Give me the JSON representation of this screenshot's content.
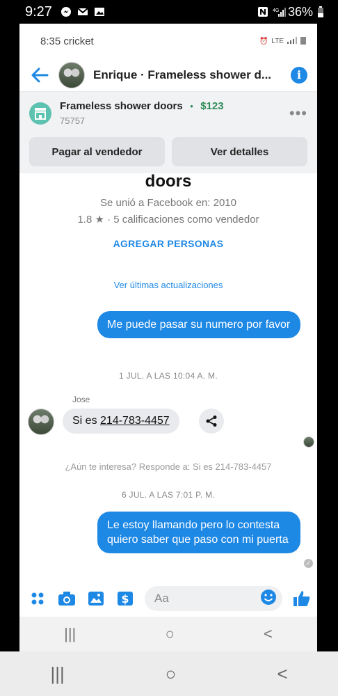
{
  "outer_status": {
    "time": "9:27",
    "battery": "36%"
  },
  "inner_status": {
    "time_carrier": "8:35 cricket",
    "signal": "LTE"
  },
  "header": {
    "title": "Enrique · Frameless shower d..."
  },
  "listing": {
    "title": "Frameless shower doors",
    "separator": "•",
    "price": "$123",
    "subtitle": "75757",
    "buttons": {
      "pay": "Pagar al vendedor",
      "details": "Ver detalles"
    }
  },
  "profile": {
    "name_tail": "doors",
    "joined": "Se unió a Facebook en: 2010",
    "rating": "1.8 ★  · 5 calificaciones como vendedor",
    "add_people": "AGREGAR PERSONAS",
    "updates": "Ver últimas actualizaciones"
  },
  "messages": {
    "out1": "Me puede pasar su numero por favor",
    "ts1": "1 JUL. A LAS 10:04 A. M.",
    "sender": "Jose",
    "in1_prefix": "Si es ",
    "in1_phone": "214-783-4457",
    "reply_hint": "¿Aún te interesa? Responde a: Si es 214-783-4457",
    "ts2": "6 JUL. A LAS 7:01 P. M.",
    "out2": "Le estoy llamando pero lo contesta quiero saber que paso con mi puerta"
  },
  "composer": {
    "placeholder": "Aa"
  },
  "nav": {
    "recent": "|||",
    "home": "○",
    "back": "<"
  },
  "colors": {
    "accent": "#1e88e5",
    "price": "#2e8b57",
    "store": "#5ec2b0"
  },
  "icons": [
    "messenger-icon",
    "gmail-icon",
    "gallery-icon",
    "nfc-icon",
    "signal-icon",
    "battery-icon",
    "back-arrow-icon",
    "info-icon",
    "store-icon",
    "more-icon",
    "share-icon",
    "apps-icon",
    "camera-icon",
    "image-icon",
    "payment-icon",
    "emoji-icon",
    "like-icon"
  ]
}
